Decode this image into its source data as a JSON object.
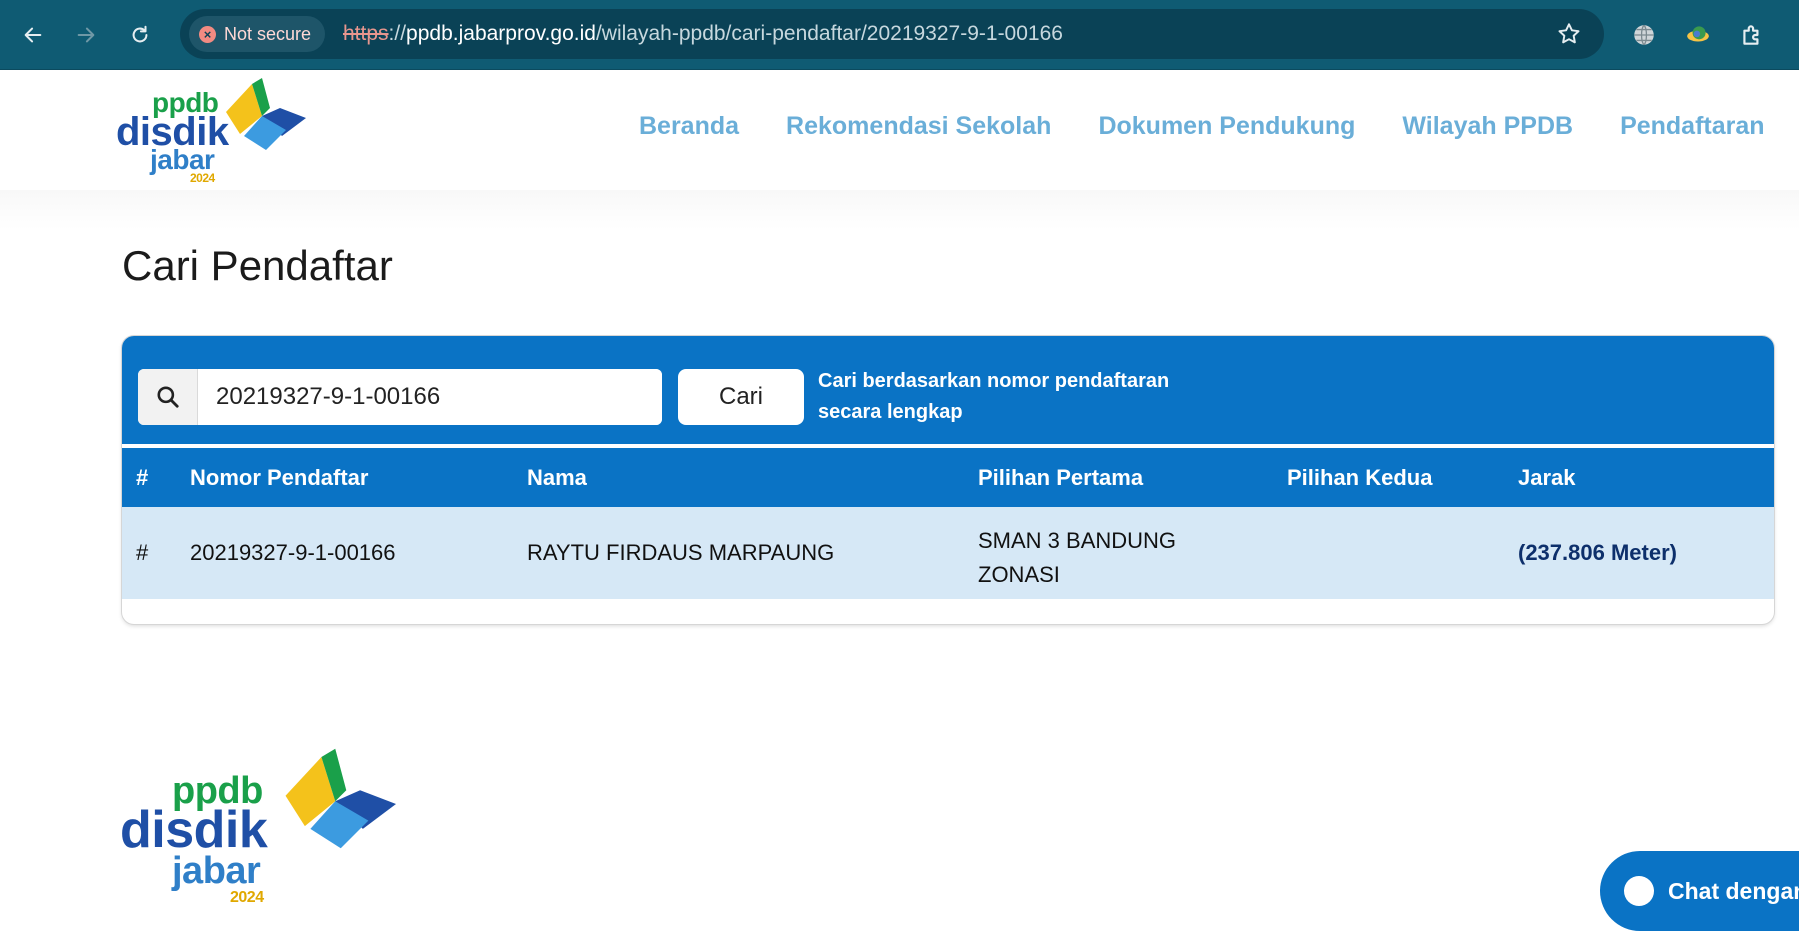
{
  "browser": {
    "security_label": "Not secure",
    "url_scheme": "https",
    "url_sep": "://",
    "url_host": "ppdb.jabarprov.go.id",
    "url_path": "/wilayah-ppdb/cari-pendaftar/20219327-9-1-00166",
    "icons": [
      "back-arrow-icon",
      "forward-arrow-icon",
      "reload-icon",
      "star-icon",
      "globe-icon",
      "extension-icon",
      "puzzle-icon"
    ]
  },
  "logo": {
    "line1": "ppdb",
    "line2": "disdik",
    "line3": "jabar",
    "year": "2024"
  },
  "nav": {
    "items": [
      "Beranda",
      "Rekomendasi Sekolah",
      "Dokumen Pendukung",
      "Wilayah PPDB",
      "Pendaftaran"
    ]
  },
  "page": {
    "title": "Cari Pendaftar"
  },
  "search": {
    "value": "20219327-9-1-00166",
    "button_label": "Cari",
    "hint_line1": "Cari berdasarkan nomor pendaftaran",
    "hint_line2": "secara lengkap"
  },
  "table": {
    "headers": [
      "#",
      "Nomor Pendaftar",
      "Nama",
      "Pilihan Pertama",
      "Pilihan Kedua",
      "Jarak"
    ],
    "rows": [
      {
        "index": "#",
        "nomor": "20219327-9-1-00166",
        "nama": "RAYTU FIRDAUS MARPAUNG",
        "pilihan_pertama_line1": "SMAN 3 BANDUNG",
        "pilihan_pertama_line2": "ZONASI",
        "pilihan_kedua": "",
        "jarak": "(237.806 Meter)"
      }
    ]
  },
  "chat": {
    "label": "Chat dengan"
  },
  "colors": {
    "primary": "#0a73c5",
    "nav_link": "#6aaed8",
    "logo_green": "#1aa04a",
    "logo_blue": "#1f4fa6",
    "logo_light_blue": "#3c9be0",
    "logo_yellow": "#f4c21b"
  }
}
